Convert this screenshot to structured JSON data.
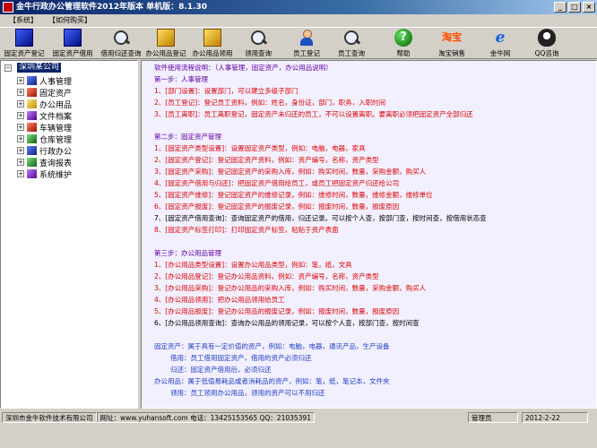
{
  "window": {
    "title": "金牛行政办公管理软件2012年版本  单机版：8.1.30",
    "buttons": [
      "_",
      "□",
      "×"
    ]
  },
  "menu": [
    "【系统】",
    "【如何购买】"
  ],
  "toolbar": [
    {
      "label": "固定资产登记",
      "icon": "blue-cube-icon"
    },
    {
      "label": "固定资产借用",
      "icon": "blue-cube-icon"
    },
    {
      "label": "借用归还查询",
      "icon": "magnifier-icon"
    },
    {
      "label": "办公用品登记",
      "icon": "yellow-cube-icon"
    },
    {
      "label": "办公用品领用",
      "icon": "yellow-cube-icon"
    },
    {
      "label": "领用查询",
      "icon": "magnifier-icon"
    },
    {
      "label": "员工登记",
      "icon": "person-icon"
    },
    {
      "label": "员工查询",
      "icon": "magnifier-icon"
    },
    {
      "label": "帮助",
      "icon": "help-icon"
    },
    {
      "label": "淘宝销售",
      "icon": "taobao-icon"
    },
    {
      "label": "金牛网",
      "icon": "ie-icon"
    },
    {
      "label": "QQ咨询",
      "icon": "qq-icon"
    }
  ],
  "icon_glyphs": {
    "help": "?",
    "taobao": "淘宝",
    "ie": "e"
  },
  "tree": {
    "root": "深圳某公司",
    "items": [
      {
        "label": "人事管理",
        "color": "blue"
      },
      {
        "label": "固定资产",
        "color": "red"
      },
      {
        "label": "办公用品",
        "color": "yellow"
      },
      {
        "label": "文件档案",
        "color": "purple"
      },
      {
        "label": "车辆管理",
        "color": "red"
      },
      {
        "label": "仓库管理",
        "color": "green"
      },
      {
        "label": "行政办公",
        "color": "blue"
      },
      {
        "label": "查询报表",
        "color": "green"
      },
      {
        "label": "系统维护",
        "color": "purple"
      }
    ]
  },
  "content": {
    "lines": [
      {
        "text": "软件使用流程说明：（人事管理，固定资产，办公用品说明）",
        "color": "purple"
      },
      {
        "text": "第一步：人事管理",
        "color": "purple"
      },
      {
        "text": "1、[部门设置]：设置部门，可以建立多级子部门",
        "color": "red"
      },
      {
        "text": "2、[员工登记]：登记员工资料，例如：姓名，身份证，部门，职务，入职时间",
        "color": "red"
      },
      {
        "text": "3、[员工离职]：员工离职登记，固定资产未归还的员工，不可以设置离职。要离职必须把固定资产全部归还",
        "color": "red"
      },
      {
        "text": "第二步：固定资产管理",
        "color": "purple"
      },
      {
        "text": "1、[固定资产类型设置]：设置固定资产类型，例如：电脑，电器，家具",
        "color": "red"
      },
      {
        "text": "2、[固定资产登记]：登记固定资产资料，例如：资产编号，名称，资产类型",
        "color": "red"
      },
      {
        "text": "3、[固定资产采购]：登记固定资产的采购入库，例如：购买时间，数量，采购金额，购买人",
        "color": "red"
      },
      {
        "text": "4、[固定资产借用与归还]：把固定资产借用给员工，或员工把固定资产归还给公司",
        "color": "red"
      },
      {
        "text": "5、[固定资产维修]：登记固定资产的维修记录，例如：维修时间，数量，维修金额，维修单位",
        "color": "red"
      },
      {
        "text": "6、[固定资产报废]：登记固定资产的报废记录，例如：报废时间，数量，报废原因",
        "color": "red"
      },
      {
        "text": "7、[固定资产借用查询]：查询固定资产的借用，归还记录。可以按个人查，按部门查，按时间查，按借用状态查",
        "color": "dark"
      },
      {
        "text": "8、[固定资产标签打印]：打印固定资产标签，粘贴于资产表面",
        "color": "red"
      },
      {
        "text": "第三步：办公用品管理",
        "color": "purple"
      },
      {
        "text": "1、[办公用品类型设置]：设置办公用品类型，例如：笔，纸，文具",
        "color": "red"
      },
      {
        "text": "2、[办公用品登记]：登记办公用品资料，例如：资产编号，名称，资产类型",
        "color": "red"
      },
      {
        "text": "3、[办公用品采购]：登记办公用品的采购入库，例如：购买时间，数量，采购金额，购买人",
        "color": "red"
      },
      {
        "text": "4、[办公用品领用]：把办公用品领用给员工",
        "color": "red"
      },
      {
        "text": "5、[办公用品报废]：登记办公用品的报废记录，例如：报废时间，数量，报废原因",
        "color": "red"
      },
      {
        "text": "6、[办公用品领用查询]：查询办公用品的领用记录，可以按个人查，按部门查，按时间查",
        "color": "dark"
      },
      {
        "text": "固定资产：属于具有一定价值的资产，例如：电脑，电器，通讯产品，生产设备",
        "color": "blue"
      },
      {
        "text": "借用：员工借用固定资产，借用的资产必须归还",
        "color": "blue"
      },
      {
        "text": "归还：固定资产借用后，必须归还",
        "color": "blue"
      },
      {
        "text": "办公用品：属于低值易耗品或者消耗品的资产，例如：笔，纸，笔记本，文件夹",
        "color": "blue"
      },
      {
        "text": "领用：员工领用办公用品，领用的资产可以不用归还",
        "color": "blue"
      }
    ]
  },
  "status": {
    "company": "深圳市金牛软件技术有限公司",
    "website": "网址：www.yuhansoft.com 电话：13425153565 QQ：21035391",
    "user": "管理员",
    "date": "2012-2-22"
  }
}
